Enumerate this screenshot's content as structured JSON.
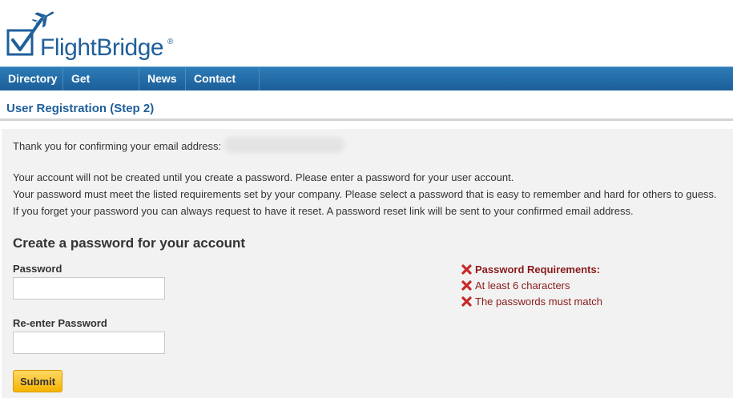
{
  "brand": {
    "name": "FlightBridge",
    "registered_mark": "®",
    "primary_color": "#1f5f9a",
    "icon": "plane-check-icon"
  },
  "nav": {
    "items": [
      {
        "label": "Directory"
      },
      {
        "label": "Get Started"
      },
      {
        "label": "News"
      },
      {
        "label": "Contact Us"
      }
    ],
    "background_color": "#1c5f99"
  },
  "page": {
    "title": "User Registration (Step 2)"
  },
  "intro": {
    "confirm_text": "Thank you for confirming your email address:",
    "line1": "Your account will not be created until you create a password. Please enter a password for your user account.",
    "line2": "Your password must meet the listed requirements set by your company. Please select a password that is easy to remember and hard for others to guess.",
    "line3": "If you forget your password you can always request to have it reset. A password reset link will be sent to your confirmed email address."
  },
  "form": {
    "heading": "Create a password for your account",
    "password_label": "Password",
    "password_value": "",
    "reenter_label": "Re-enter Password",
    "reenter_value": "",
    "submit_label": "Submit",
    "submit_color": "#f5b400"
  },
  "requirements": {
    "heading": "Password Requirements:",
    "items": [
      {
        "label": "At least 6 characters",
        "status": "failed"
      },
      {
        "label": "The passwords must match",
        "status": "failed"
      }
    ],
    "error_color": "#8a1a1a",
    "icon": "x-icon"
  }
}
